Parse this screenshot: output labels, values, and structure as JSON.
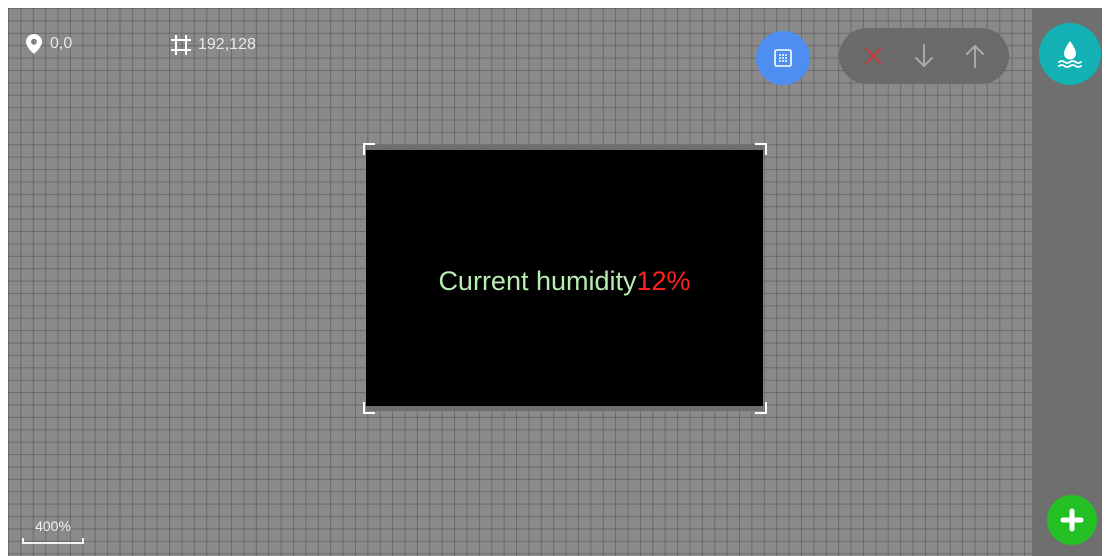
{
  "toolbar": {
    "position": "0,0",
    "size": "192,128",
    "zoom": "400%"
  },
  "screen": {
    "label": "Current humidity",
    "value": "12%",
    "label_color": "#b6ecb0",
    "value_color": "#ff2020"
  },
  "icons": {
    "position": "map-pin-icon",
    "size": "crop-size-icon",
    "grid": "grid-snap-icon",
    "delete": "close-icon",
    "move_down": "arrow-down-icon",
    "move_up": "arrow-up-icon",
    "humidity": "water-drop-icon",
    "add": "plus-icon"
  },
  "colors": {
    "canvas": "#8a8a8a",
    "grid_button": "#4d8ef0",
    "humidity_button": "#13b1b3",
    "add_button": "#23c023",
    "delete": "#c23b3b"
  }
}
